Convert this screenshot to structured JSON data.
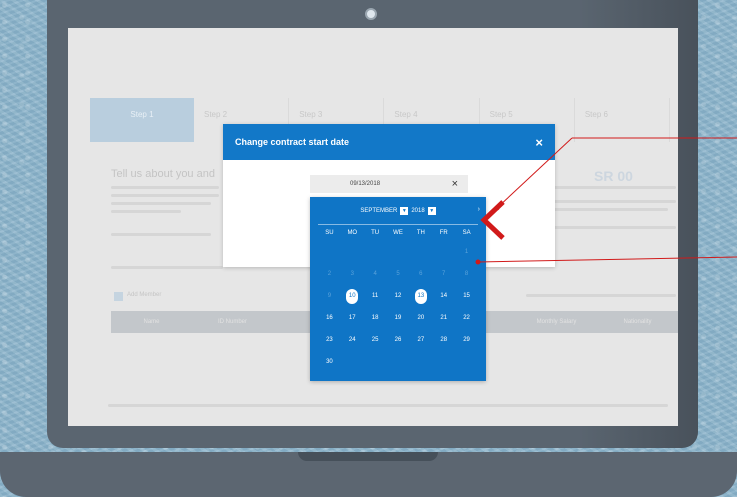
{
  "modal": {
    "title": "Change contract start date",
    "close_icon": "×"
  },
  "date_input": {
    "value": "09/13/2018",
    "clear_icon": "×"
  },
  "calendar": {
    "month": "SEPTEMBER",
    "year": "2018",
    "dropdown_icon": "chevron-down-icon",
    "next_icon": "chevron-right-icon",
    "weekdays": [
      "SU",
      "MO",
      "TU",
      "WE",
      "TH",
      "FR",
      "SA"
    ],
    "rows": [
      [
        {
          "t": "",
          "off": true
        },
        {
          "t": "",
          "off": true
        },
        {
          "t": "",
          "off": true
        },
        {
          "t": "",
          "off": true
        },
        {
          "t": "",
          "off": true
        },
        {
          "t": "",
          "off": true
        },
        {
          "t": "1",
          "off": true
        }
      ],
      [
        {
          "t": "2",
          "off": true
        },
        {
          "t": "3",
          "off": true
        },
        {
          "t": "4",
          "off": true
        },
        {
          "t": "5",
          "off": true
        },
        {
          "t": "6",
          "off": true
        },
        {
          "t": "7",
          "off": true
        },
        {
          "t": "8",
          "off": true
        }
      ],
      [
        {
          "t": "9",
          "off": true
        },
        {
          "t": "10",
          "mark": true
        },
        {
          "t": "11"
        },
        {
          "t": "12"
        },
        {
          "t": "13",
          "mark": true
        },
        {
          "t": "14"
        },
        {
          "t": "15"
        }
      ],
      [
        {
          "t": "16"
        },
        {
          "t": "17"
        },
        {
          "t": "18"
        },
        {
          "t": "19"
        },
        {
          "t": "20"
        },
        {
          "t": "21"
        },
        {
          "t": "22"
        }
      ],
      [
        {
          "t": "23"
        },
        {
          "t": "24"
        },
        {
          "t": "25"
        },
        {
          "t": "26"
        },
        {
          "t": "27"
        },
        {
          "t": "28"
        },
        {
          "t": "29"
        }
      ],
      [
        {
          "t": "30"
        },
        {
          "t": ""
        },
        {
          "t": ""
        },
        {
          "t": ""
        },
        {
          "t": ""
        },
        {
          "t": ""
        },
        {
          "t": ""
        }
      ]
    ]
  },
  "background_page": {
    "steps": [
      {
        "label": "Step 1",
        "sub": "",
        "active": true
      },
      {
        "label": "Step 2",
        "sub": ""
      },
      {
        "label": "Step 3",
        "sub": ""
      },
      {
        "label": "Step 4",
        "sub": ""
      },
      {
        "label": "Step 5",
        "sub": ""
      },
      {
        "label": "Step 6",
        "sub": ""
      }
    ],
    "heading": "Tell us about you and",
    "amount": "SR 00",
    "add_label": "Add Member",
    "table_headers": [
      "Name",
      "ID Number",
      "",
      "",
      "",
      "Monthly Salary",
      "Nationality"
    ]
  },
  "colors": {
    "accent": "#1278c8",
    "calendar_bg": "#0f75c6",
    "annotation": "#d11a1a",
    "laptop": "#5a6570"
  }
}
